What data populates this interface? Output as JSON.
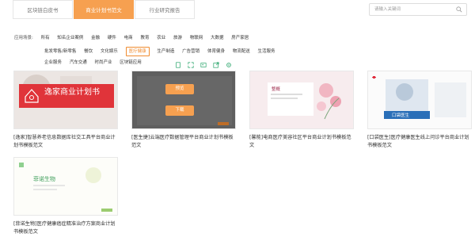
{
  "tabs": [
    {
      "label": "区块链白皮书"
    },
    {
      "label": "商业计划书范文"
    },
    {
      "label": "行业研究报告"
    }
  ],
  "search": {
    "placeholder": "请输入关键词"
  },
  "filters": {
    "label": "应用场景:",
    "row1": [
      "所有",
      "知名企业案例",
      "金融",
      "硬件",
      "电商",
      "教育",
      "农业",
      "旅游",
      "物联网",
      "大数据",
      "房产家居"
    ],
    "row2": [
      "批发零售/新零售",
      "餐饮",
      "文化娱乐",
      "医疗健康",
      "生产制造",
      "广告营销",
      "体育健身",
      "物流配送",
      "生活服务"
    ],
    "row3": [
      "企业服务",
      "汽车交通",
      "时尚产业",
      "区块链应用"
    ],
    "active": "医疗健康"
  },
  "cards": [
    {
      "title": "[逸家]智慧养老信息数据库社交工具平台商业计划书模板范文",
      "thumb_text": "逸家商业计划书"
    },
    {
      "title": "[医生捷]云端医疗数据管理平台商业计划书模板范文",
      "preview_label": "预览",
      "download_label": "下载"
    },
    {
      "title": "[馨能]电商医疗美容社区平台商业计划书模板范文",
      "thumb_text": "整概"
    },
    {
      "title": "[口袋医生]医疗健康医生线上问诊平台商业计划书模板范文",
      "thumb_text": "口袋医生"
    },
    {
      "title": "[菲诺生物]医疗健康癌症精准治疗方案商业计划书模板范文",
      "thumb_text": "菲诺生物"
    }
  ],
  "colors": {
    "accent": "#f6a050",
    "active_filter": "#f08c30"
  }
}
